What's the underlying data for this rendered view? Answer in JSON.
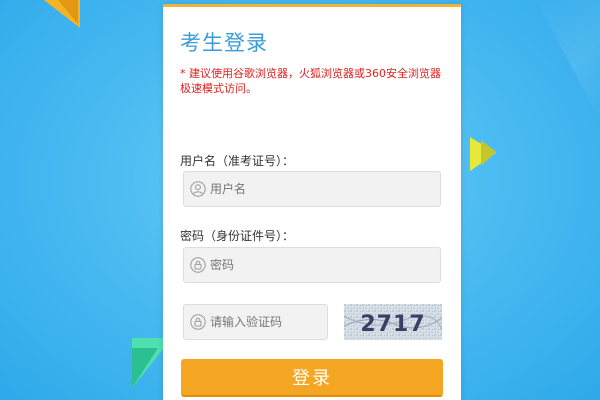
{
  "login": {
    "title": "考生登录",
    "notice": "* 建议使用谷歌浏览器，火狐浏览器或360安全浏览器极速模式访问。",
    "username_label": "用户名（准考证号）：",
    "username_placeholder": "用户名",
    "password_label": "密码（身份证件号）：",
    "password_placeholder": "密码",
    "captcha_placeholder": "请输入验证码",
    "captcha_code": "2717",
    "submit_label": "登录"
  },
  "colors": {
    "accent": "#f5a623",
    "title": "#3a9ed8",
    "notice": "#e02020",
    "background": "#4cbcf2"
  },
  "icons": {
    "user_icon": "user-icon",
    "lock_icon": "lock-icon"
  }
}
